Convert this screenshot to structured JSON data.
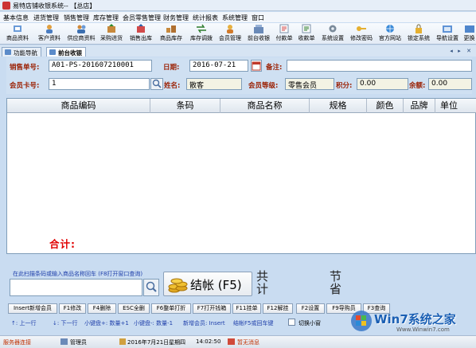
{
  "window": {
    "title": "易特店铺收银系统-- 【总店】"
  },
  "menu": [
    "基本信息",
    "进货管理",
    "销售管理",
    "库存管理",
    "会员零售管理",
    "财务管理",
    "统计报表",
    "系统管理",
    "窗口"
  ],
  "toolbar": [
    "商品资料",
    "客户资料",
    "供应商资料",
    "采购进货",
    "销售出库",
    "商品库存",
    "库存调拨",
    "会员管理",
    "前台收银",
    "付款单",
    "收款单",
    "系统设置",
    "修改密码",
    "官方网站",
    "锁定系统",
    "导航设置",
    "更换"
  ],
  "tabs": [
    {
      "label": "功能导航",
      "active": false
    },
    {
      "label": "前台收银",
      "active": true
    }
  ],
  "form": {
    "order_label": "销售单号:",
    "order_value": "A01-PS-201607210001",
    "date_label": "日期:",
    "date_value": "2016-07-21",
    "note_label": "备注:",
    "note_value": "",
    "member_label": "会员卡号:",
    "member_value": "1",
    "name_label": "姓名:",
    "name_value": "散客",
    "level_label": "会员等级:",
    "level_value": "零售会员",
    "points_label": "积分:",
    "points_value": "0.00",
    "balance_label": "余额:",
    "balance_value": "0.00"
  },
  "grid": {
    "columns": [
      "商品编码",
      "条码",
      "商品名称",
      "规格",
      "颜色",
      "品牌",
      "单位"
    ]
  },
  "total_label": "合计:",
  "scan_hint": "在此扫描条码或输入商品名称回车 (F8打开窗口查询)",
  "checkout_label": "结帐 (F5)",
  "summary": {
    "sum_label": "共计",
    "save_label": "节省"
  },
  "fkeys": [
    "Insert新增会员",
    "F1修改",
    "F4删除",
    "ESC全删",
    "F6整单打折",
    "F7打开钱箱",
    "F11挂单",
    "F12解挂",
    "F2设置",
    "F9导购员",
    "F3查询"
  ],
  "shortcuts": [
    "↑: 上一行",
    "↓: 下一行",
    "小键盘+: 数量+1",
    "小键盘-: 数量-1",
    "新增会员: Insert",
    "结帐F5或回车键"
  ],
  "toggle_label": "切换小窗",
  "status": {
    "connected": "服务器连接",
    "user": "管理员",
    "date": "2016年7月21日",
    "weekday": "星期四",
    "time": "14:02:50",
    "messages": "暂无消息"
  },
  "watermark": {
    "brand": "Win7系统之家",
    "url": "Www.Winwin7.com"
  },
  "colors": {
    "label_red": "#9a1e00",
    "total_red": "#e00000",
    "hint_blue": "#1f3faa",
    "accent_blue": "#5b8bc9"
  }
}
